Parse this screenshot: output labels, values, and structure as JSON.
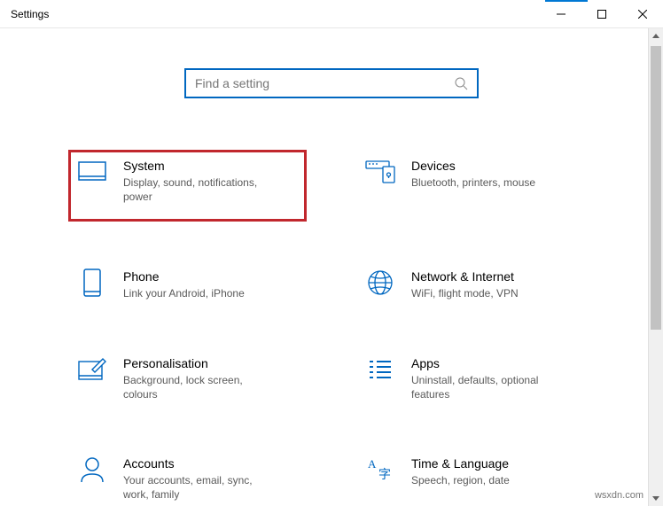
{
  "window": {
    "title": "Settings"
  },
  "search": {
    "placeholder": "Find a setting"
  },
  "tiles": [
    {
      "title": "System",
      "desc": "Display, sound, notifications, power",
      "highlighted": true
    },
    {
      "title": "Devices",
      "desc": "Bluetooth, printers, mouse",
      "highlighted": false
    },
    {
      "title": "Phone",
      "desc": "Link your Android, iPhone",
      "highlighted": false
    },
    {
      "title": "Network & Internet",
      "desc": "WiFi, flight mode, VPN",
      "highlighted": false
    },
    {
      "title": "Personalisation",
      "desc": "Background, lock screen, colours",
      "highlighted": false
    },
    {
      "title": "Apps",
      "desc": "Uninstall, defaults, optional features",
      "highlighted": false
    },
    {
      "title": "Accounts",
      "desc": "Your accounts, email, sync, work, family",
      "highlighted": false
    },
    {
      "title": "Time & Language",
      "desc": "Speech, region, date",
      "highlighted": false
    }
  ],
  "watermark": "wsxdn.com"
}
